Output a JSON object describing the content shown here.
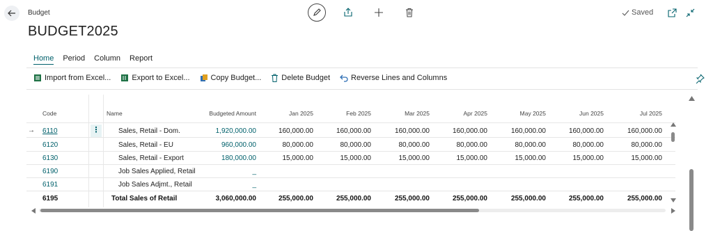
{
  "header": {
    "breadcrumb": "Budget",
    "title": "BUDGET2025",
    "status": "Saved"
  },
  "icons": {
    "back": "arrow-left-icon",
    "edit": "pencil-icon",
    "share": "share-icon",
    "add": "plus-icon",
    "delete": "trash-icon",
    "saved": "check-icon",
    "open_new": "open-in-new-window-icon",
    "collapse": "collapse-icon",
    "pin": "pin-icon"
  },
  "tabs": [
    {
      "label": "Home",
      "active": true
    },
    {
      "label": "Period",
      "active": false
    },
    {
      "label": "Column",
      "active": false
    },
    {
      "label": "Report",
      "active": false
    }
  ],
  "actions": [
    {
      "label": "Import from Excel...",
      "icon": "excel-import-icon"
    },
    {
      "label": "Export to Excel...",
      "icon": "excel-export-icon"
    },
    {
      "label": "Copy Budget...",
      "icon": "copy-icon"
    },
    {
      "label": "Delete Budget",
      "icon": "trash-icon"
    },
    {
      "label": "Reverse Lines and Columns",
      "icon": "reverse-arrow-icon"
    }
  ],
  "grid": {
    "columns": {
      "code": "Code",
      "name": "Name",
      "budgeted": "Budgeted Amount",
      "jan": "Jan 2025",
      "feb": "Feb 2025",
      "mar": "Mar 2025",
      "apr": "Apr 2025",
      "may": "May 2025",
      "jun": "Jun 2025",
      "jul": "Jul 2025"
    },
    "rows": [
      {
        "code": "6110",
        "name": "Sales, Retail - Dom.",
        "budgeted": "1,920,000.00",
        "jan": "160,000.00",
        "feb": "160,000.00",
        "mar": "160,000.00",
        "apr": "160,000.00",
        "may": "160,000.00",
        "jun": "160,000.00",
        "jul": "160,000.00",
        "selected": true
      },
      {
        "code": "6120",
        "name": "Sales, Retail - EU",
        "budgeted": "960,000.00",
        "jan": "80,000.00",
        "feb": "80,000.00",
        "mar": "80,000.00",
        "apr": "80,000.00",
        "may": "80,000.00",
        "jun": "80,000.00",
        "jul": "80,000.00"
      },
      {
        "code": "6130",
        "name": "Sales, Retail - Export",
        "budgeted": "180,000.00",
        "jan": "15,000.00",
        "feb": "15,000.00",
        "mar": "15,000.00",
        "apr": "15,000.00",
        "may": "15,000.00",
        "jun": "15,000.00",
        "jul": "15,000.00"
      },
      {
        "code": "6190",
        "name": "Job Sales Applied, Retail",
        "budgeted": "_",
        "jan": "",
        "feb": "",
        "mar": "",
        "apr": "",
        "may": "",
        "jun": "",
        "jul": ""
      },
      {
        "code": "6191",
        "name": "Job Sales Adjmt., Retail",
        "budgeted": "_",
        "jan": "",
        "feb": "",
        "mar": "",
        "apr": "",
        "may": "",
        "jun": "",
        "jul": ""
      },
      {
        "code": "6195",
        "name": "Total Sales of Retail",
        "budgeted": "3,060,000.00",
        "jan": "255,000.00",
        "feb": "255,000.00",
        "mar": "255,000.00",
        "apr": "255,000.00",
        "may": "255,000.00",
        "jun": "255,000.00",
        "jul": "255,000.00",
        "total": true
      }
    ]
  },
  "colors": {
    "accent": "#00606b",
    "scrollbar": "#8a8a8a",
    "divider": "#e3e3e3"
  }
}
